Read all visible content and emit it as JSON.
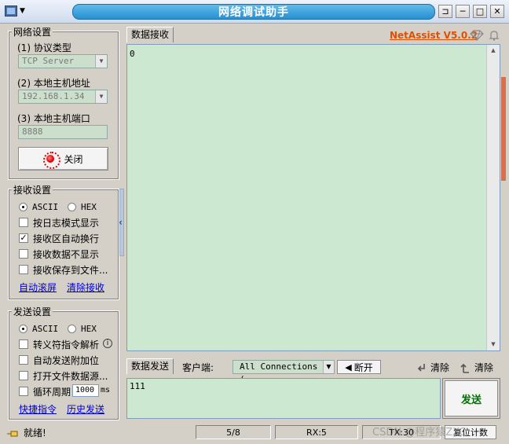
{
  "window": {
    "title": "网络调试助手",
    "controls": {
      "pin": "⊐",
      "minimize": "─",
      "maximize": "□",
      "close": "✕"
    }
  },
  "network_settings": {
    "title": "网络设置",
    "protocol_label": "(1) 协议类型",
    "protocol_value": "TCP Server",
    "host_label": "(2) 本地主机地址",
    "host_value": "192.168.1.34",
    "port_label": "(3) 本地主机端口",
    "port_value": "8888",
    "close_button": "关闭"
  },
  "receive_settings": {
    "title": "接收设置",
    "ascii": "ASCII",
    "hex": "HEX",
    "selected": "ASCII",
    "options": [
      {
        "label": "按日志模式显示",
        "checked": false
      },
      {
        "label": "接收区自动换行",
        "checked": true
      },
      {
        "label": "接收数据不显示",
        "checked": false
      },
      {
        "label": "接收保存到文件...",
        "checked": false
      }
    ],
    "auto_scroll": "自动滚屏",
    "clear_receive": "清除接收"
  },
  "send_settings": {
    "title": "发送设置",
    "ascii": "ASCII",
    "hex": "HEX",
    "selected": "ASCII",
    "options": [
      {
        "label": "转义符指令解析",
        "checked": false
      },
      {
        "label": "自动发送附加位",
        "checked": false
      },
      {
        "label": "打开文件数据源...",
        "checked": false
      },
      {
        "label": "循环周期",
        "checked": false
      }
    ],
    "period_value": "1000",
    "period_unit": "ms",
    "shortcut": "快捷指令",
    "history": "历史发送"
  },
  "receive_panel": {
    "tab": "数据接收",
    "brand": "NetAssist V5.0.2",
    "content": "0"
  },
  "send_panel": {
    "tab": "数据发送",
    "client_label": "客户端:",
    "client_value": "All Connections (",
    "disconnect": "断开",
    "clear1": "清除",
    "clear2": "清除",
    "content": "111",
    "send_button": "发送"
  },
  "status": {
    "ready": "就绪!",
    "counter": "5/8",
    "rx": "RX:5",
    "tx": "TX:30",
    "reset": "复位计数",
    "watermark": "CSDN @程序猿ZXC"
  },
  "colors": {
    "title_accent": "#2a8fd1",
    "brand": "#e05000",
    "text_area": "#cce8d0",
    "send_green": "#007000"
  }
}
